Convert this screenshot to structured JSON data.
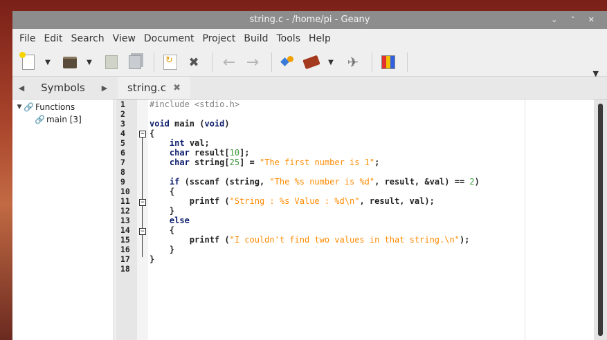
{
  "window": {
    "title": "string.c - /home/pi - Geany",
    "controls": "⌄ ˄ ✕"
  },
  "menu": [
    "File",
    "Edit",
    "Search",
    "View",
    "Document",
    "Project",
    "Build",
    "Tools",
    "Help"
  ],
  "sidebar": {
    "tab_label": "Symbols",
    "tree": [
      {
        "label": "Functions"
      },
      {
        "label": "main [3]"
      }
    ]
  },
  "document": {
    "tab_label": "string.c",
    "close_glyph": "✖"
  },
  "editor": {
    "line_numbers": [
      "1",
      "2",
      "3",
      "4",
      "5",
      "6",
      "7",
      "8",
      "9",
      "10",
      "11",
      "12",
      "13",
      "14",
      "15",
      "16",
      "17",
      "18"
    ]
  }
}
